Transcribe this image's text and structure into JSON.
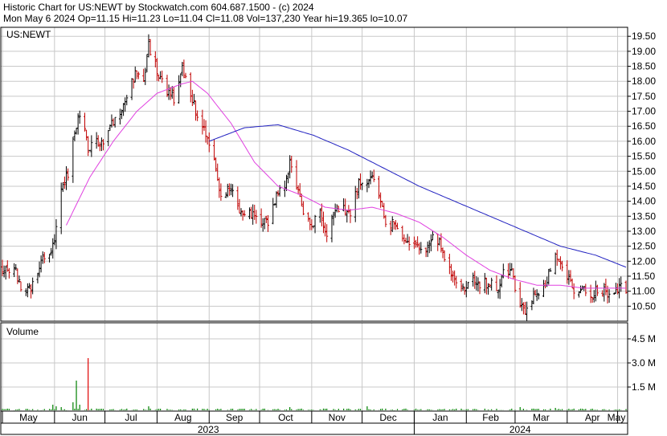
{
  "header": {
    "line1": "Historic Chart for US:NEWT by Stockwatch.com 604.687.1500 - (c) 2024",
    "line2": "Mon May  6 2024  Op=11.15  Hi=11.23  Lo=11.04  Cl=11.08  Vol=137,230  Year hi=19.365  lo=10.07"
  },
  "colors": {
    "background": "#ffffff",
    "grid": "#c8c8c8",
    "frame": "#000000",
    "bar_up": "#000000",
    "bar_down": "#c00000",
    "ma_short": "#e040e0",
    "ma_long": "#2020c0",
    "volume": "#008000",
    "volume_spike": "#e00000"
  },
  "chart_data": [
    {
      "type": "ohlc",
      "title": "US:NEWT",
      "ylim": [
        10.0,
        19.8
      ],
      "y_ticks": [
        10.5,
        11.0,
        11.5,
        12.0,
        12.5,
        13.0,
        13.5,
        14.0,
        14.5,
        15.0,
        15.5,
        16.0,
        16.5,
        17.0,
        17.5,
        18.0,
        18.5,
        19.0,
        19.5
      ],
      "y_tick_labels": [
        "10.50",
        "11.00",
        "11.50",
        "12.00",
        "12.50",
        "13.00",
        "13.50",
        "14.00",
        "14.50",
        "15.00",
        "15.50",
        "16.00",
        "16.50",
        "17.00",
        "17.50",
        "18.00",
        "18.50",
        "19.00",
        "19.50"
      ],
      "grid": true,
      "close_anchors": [
        [
          "2023-05-08",
          11.8
        ],
        [
          "2023-05-12",
          11.2
        ],
        [
          "2023-05-17",
          11.0
        ],
        [
          "2023-05-22",
          11.7
        ],
        [
          "2023-05-26",
          12.2
        ],
        [
          "2023-05-31",
          12.5
        ],
        [
          "2023-06-02",
          13.2
        ],
        [
          "2023-06-06",
          14.6
        ],
        [
          "2023-06-09",
          14.9
        ],
        [
          "2023-06-14",
          16.6
        ],
        [
          "2023-06-16",
          17.0
        ],
        [
          "2023-06-21",
          15.8
        ],
        [
          "2023-06-26",
          16.0
        ],
        [
          "2023-06-30",
          16.0
        ],
        [
          "2023-07-05",
          16.6
        ],
        [
          "2023-07-10",
          17.0
        ],
        [
          "2023-07-14",
          17.6
        ],
        [
          "2023-07-19",
          18.2
        ],
        [
          "2023-07-24",
          18.0
        ],
        [
          "2023-07-27",
          19.2
        ],
        [
          "2023-07-31",
          18.5
        ],
        [
          "2023-08-03",
          18.0
        ],
        [
          "2023-08-08",
          17.6
        ],
        [
          "2023-08-11",
          17.4
        ],
        [
          "2023-08-16",
          18.4
        ],
        [
          "2023-08-21",
          17.5
        ],
        [
          "2023-08-24",
          17.0
        ],
        [
          "2023-08-29",
          16.4
        ],
        [
          "2023-09-01",
          15.9
        ],
        [
          "2023-09-05",
          15.0
        ],
        [
          "2023-09-08",
          14.2
        ],
        [
          "2023-09-13",
          14.5
        ],
        [
          "2023-09-18",
          13.8
        ],
        [
          "2023-09-22",
          13.5
        ],
        [
          "2023-09-27",
          13.6
        ],
        [
          "2023-10-02",
          13.4
        ],
        [
          "2023-10-06",
          13.2
        ],
        [
          "2023-10-11",
          14.2
        ],
        [
          "2023-10-16",
          14.4
        ],
        [
          "2023-10-19",
          15.3
        ],
        [
          "2023-10-24",
          14.4
        ],
        [
          "2023-10-27",
          13.5
        ],
        [
          "2023-11-01",
          13.2
        ],
        [
          "2023-11-06",
          13.6
        ],
        [
          "2023-11-10",
          13.0
        ],
        [
          "2023-11-15",
          13.6
        ],
        [
          "2023-11-20",
          13.8
        ],
        [
          "2023-11-24",
          13.5
        ],
        [
          "2023-11-29",
          14.6
        ],
        [
          "2023-12-04",
          14.6
        ],
        [
          "2023-12-07",
          14.8
        ],
        [
          "2023-12-12",
          14.0
        ],
        [
          "2023-12-15",
          13.4
        ],
        [
          "2023-12-20",
          13.2
        ],
        [
          "2023-12-27",
          12.8
        ],
        [
          "2024-01-02",
          12.5
        ],
        [
          "2024-01-08",
          12.3
        ],
        [
          "2024-01-12",
          13.0
        ],
        [
          "2024-01-17",
          12.5
        ],
        [
          "2024-01-22",
          11.8
        ],
        [
          "2024-01-26",
          11.3
        ],
        [
          "2024-01-31",
          11.1
        ],
        [
          "2024-02-05",
          11.5
        ],
        [
          "2024-02-09",
          11.2
        ],
        [
          "2024-02-14",
          11.3
        ],
        [
          "2024-02-20",
          11.1
        ],
        [
          "2024-02-23",
          11.8
        ],
        [
          "2024-02-28",
          11.6
        ],
        [
          "2024-03-04",
          10.5
        ],
        [
          "2024-03-07",
          10.3
        ],
        [
          "2024-03-12",
          10.9
        ],
        [
          "2024-03-15",
          11.0
        ],
        [
          "2024-03-20",
          11.4
        ],
        [
          "2024-03-25",
          12.2
        ],
        [
          "2024-03-28",
          12.0
        ],
        [
          "2024-04-02",
          11.4
        ],
        [
          "2024-04-05",
          11.0
        ],
        [
          "2024-04-10",
          11.0
        ],
        [
          "2024-04-15",
          10.9
        ],
        [
          "2024-04-19",
          11.0
        ],
        [
          "2024-04-24",
          11.0
        ],
        [
          "2024-04-29",
          10.9
        ],
        [
          "2024-05-02",
          11.1
        ],
        [
          "2024-05-06",
          11.08
        ]
      ],
      "ma_short_anchors": [
        [
          "2023-06-08",
          13.2
        ],
        [
          "2023-06-22",
          14.8
        ],
        [
          "2023-07-06",
          16.0
        ],
        [
          "2023-07-20",
          17.0
        ],
        [
          "2023-08-01",
          17.6
        ],
        [
          "2023-08-15",
          17.9
        ],
        [
          "2023-08-22",
          18.0
        ],
        [
          "2023-08-31",
          17.6
        ],
        [
          "2023-09-14",
          16.6
        ],
        [
          "2023-09-28",
          15.3
        ],
        [
          "2023-10-12",
          14.5
        ],
        [
          "2023-10-26",
          14.2
        ],
        [
          "2023-11-09",
          13.8
        ],
        [
          "2023-11-23",
          13.7
        ],
        [
          "2023-12-07",
          13.8
        ],
        [
          "2023-12-21",
          13.6
        ],
        [
          "2024-01-04",
          13.3
        ],
        [
          "2024-01-18",
          12.8
        ],
        [
          "2024-02-01",
          12.2
        ],
        [
          "2024-02-15",
          11.7
        ],
        [
          "2024-02-29",
          11.4
        ],
        [
          "2024-03-14",
          11.2
        ],
        [
          "2024-03-28",
          11.2
        ],
        [
          "2024-04-11",
          11.1
        ],
        [
          "2024-04-25",
          11.1
        ],
        [
          "2024-05-06",
          11.1
        ]
      ],
      "ma_long_anchors": [
        [
          "2023-09-01",
          16.0
        ],
        [
          "2023-09-22",
          16.45
        ],
        [
          "2023-10-12",
          16.55
        ],
        [
          "2023-11-02",
          16.2
        ],
        [
          "2023-11-23",
          15.7
        ],
        [
          "2023-12-14",
          15.1
        ],
        [
          "2024-01-04",
          14.5
        ],
        [
          "2024-01-25",
          14.0
        ],
        [
          "2024-02-15",
          13.5
        ],
        [
          "2024-03-07",
          13.0
        ],
        [
          "2024-03-28",
          12.5
        ],
        [
          "2024-04-18",
          12.2
        ],
        [
          "2024-05-06",
          11.8
        ]
      ]
    },
    {
      "type": "bar",
      "title": "Volume",
      "ylim": [
        0,
        5.5
      ],
      "y_ticks": [
        1.5,
        3.0,
        4.5
      ],
      "y_tick_labels": [
        "1.5 M",
        "3.0 M",
        "4.5 M"
      ],
      "spikes": [
        [
          "2023-05-31",
          0.4
        ],
        [
          "2023-06-02",
          0.3
        ],
        [
          "2023-06-05",
          0.25
        ],
        [
          "2023-06-12",
          0.55
        ],
        [
          "2023-06-14",
          1.9
        ],
        [
          "2023-06-16",
          0.4
        ],
        [
          "2023-06-21",
          3.3
        ],
        [
          "2023-07-27",
          0.3
        ],
        [
          "2023-10-19",
          0.25
        ],
        [
          "2023-12-04",
          0.3
        ],
        [
          "2024-03-04",
          0.25
        ],
        [
          "2024-03-25",
          0.2
        ]
      ],
      "spike_red_date": "2023-06-21"
    }
  ],
  "x_axis": {
    "start": "2023-05-01",
    "end": "2024-05-06",
    "months": [
      {
        "label": "May",
        "date": "2023-05-01"
      },
      {
        "label": "Jun",
        "date": "2023-06-01"
      },
      {
        "label": "Jul",
        "date": "2023-07-01"
      },
      {
        "label": "Aug",
        "date": "2023-08-01"
      },
      {
        "label": "Sep",
        "date": "2023-09-01"
      },
      {
        "label": "Oct",
        "date": "2023-10-01"
      },
      {
        "label": "Nov",
        "date": "2023-11-01"
      },
      {
        "label": "Dec",
        "date": "2023-12-01"
      },
      {
        "label": "Jan",
        "date": "2024-01-01"
      },
      {
        "label": "Feb",
        "date": "2024-02-01"
      },
      {
        "label": "Mar",
        "date": "2024-03-01"
      },
      {
        "label": "Apr",
        "date": "2024-04-01"
      },
      {
        "label": "May",
        "date": "2024-05-01"
      }
    ],
    "years": [
      {
        "label": "2023",
        "start": "2023-05-01",
        "end": "2024-01-01"
      },
      {
        "label": "2024",
        "start": "2024-01-01",
        "end": "2024-05-06"
      }
    ]
  }
}
